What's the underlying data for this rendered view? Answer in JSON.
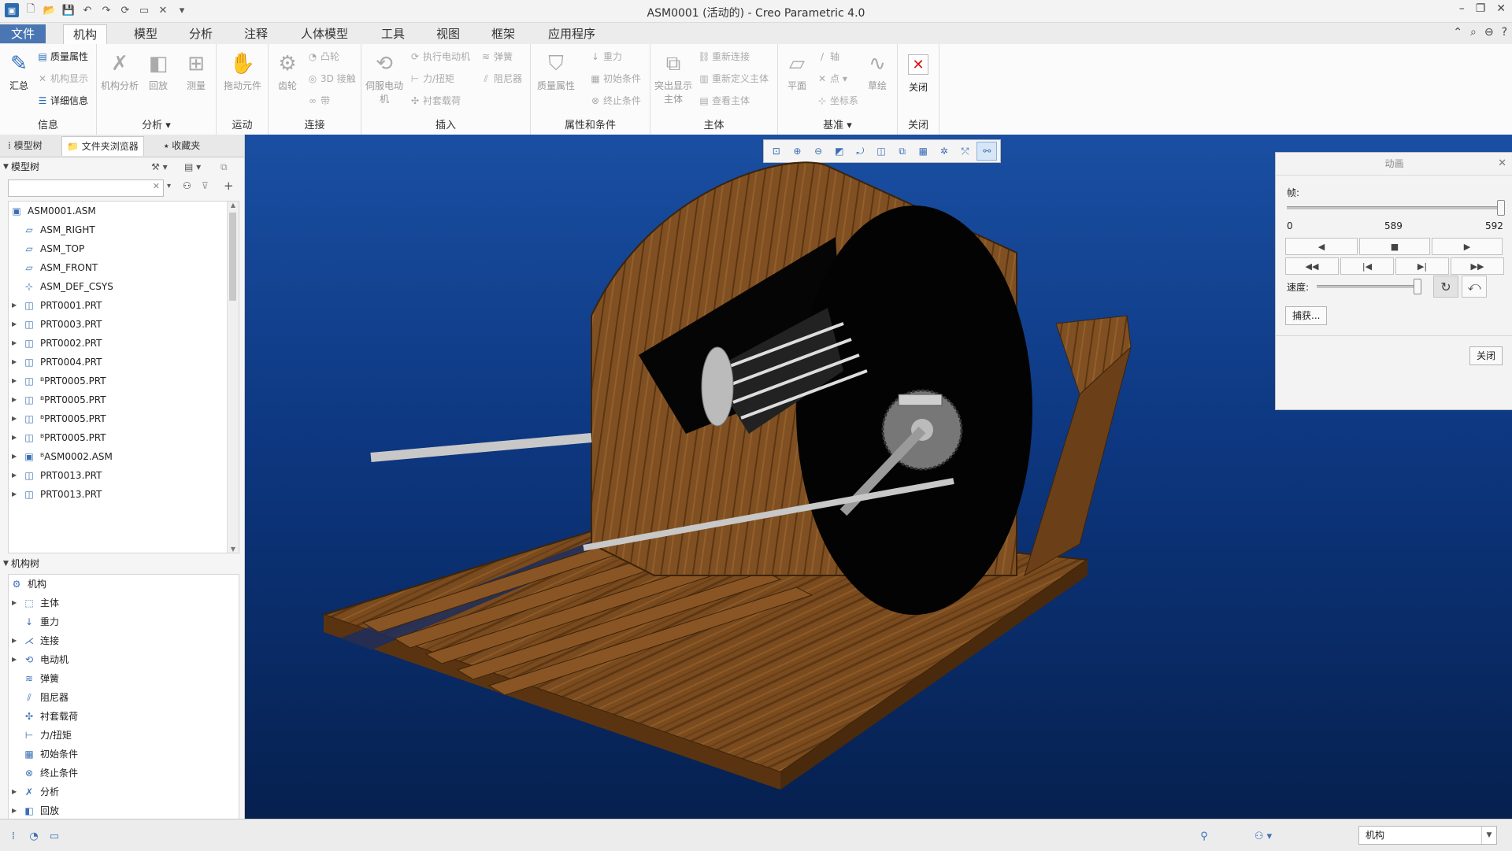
{
  "window": {
    "title": "ASM0001 (活动的) - Creo Parametric 4.0"
  },
  "tabs": [
    "文件",
    "机构",
    "模型",
    "分析",
    "注释",
    "人体模型",
    "工具",
    "视图",
    "框架",
    "应用程序"
  ],
  "ribbon": {
    "info": {
      "group": "信息",
      "summary": "汇总",
      "mass_props": "质量属性",
      "mech_display": "机构显示",
      "details": "详细信息"
    },
    "analysis": {
      "group": "分析",
      "mech_analysis": "机构分析",
      "playback": "回放",
      "measure": "测量"
    },
    "motion": {
      "group": "运动",
      "drag": "拖动元件"
    },
    "connect": {
      "group": "连接",
      "gear": "齿轮",
      "cam": "凸轮",
      "contact": "3D 接触",
      "belt": "带"
    },
    "insert": {
      "group": "插入",
      "servo": "伺服电动机",
      "exec_motor": "执行电动机",
      "force_torque": "力/扭矩",
      "bushing": "衬套载荷",
      "spring": "弹簧",
      "damper": "阻尼器"
    },
    "props": {
      "group": "属性和条件",
      "mass_props": "质量属性",
      "gravity": "重力",
      "init_cond": "初始条件",
      "term_cond": "终止条件"
    },
    "body": {
      "group": "主体",
      "highlight": "突出显示主体",
      "reconnect": "重新连接",
      "redefine": "重新定义主体",
      "view": "查看主体"
    },
    "datum": {
      "group": "基准",
      "plane": "平面",
      "axis": "轴",
      "point": "点",
      "csys": "坐标系",
      "sketch": "草绘"
    },
    "close": {
      "group": "关闭",
      "close": "关闭"
    }
  },
  "left_panel": {
    "tabs": [
      "模型树",
      "文件夹浏览器",
      "收藏夹"
    ],
    "model_tree": {
      "header": "模型树",
      "items": [
        {
          "label": "ASM0001.ASM",
          "icon": "assembly-icon",
          "expand": ""
        },
        {
          "label": "ASM_RIGHT",
          "icon": "datum-plane-icon",
          "expand": ""
        },
        {
          "label": "ASM_TOP",
          "icon": "datum-plane-icon",
          "expand": ""
        },
        {
          "label": "ASM_FRONT",
          "icon": "datum-plane-icon",
          "expand": ""
        },
        {
          "label": "ASM_DEF_CSYS",
          "icon": "csys-icon",
          "expand": ""
        },
        {
          "label": "PRT0001.PRT",
          "icon": "part-icon",
          "expand": "▶"
        },
        {
          "label": "PRT0003.PRT",
          "icon": "part-icon",
          "expand": "▶"
        },
        {
          "label": "PRT0002.PRT",
          "icon": "part-icon",
          "expand": "▶"
        },
        {
          "label": "PRT0004.PRT",
          "icon": "part-icon",
          "expand": "▶"
        },
        {
          "label": "ᴮPRT0005.PRT",
          "icon": "part-icon",
          "expand": "▶"
        },
        {
          "label": "ᴮPRT0005.PRT",
          "icon": "part-icon",
          "expand": "▶"
        },
        {
          "label": "ᴮPRT0005.PRT",
          "icon": "part-icon",
          "expand": "▶"
        },
        {
          "label": "ᴮPRT0005.PRT",
          "icon": "part-icon",
          "expand": "▶"
        },
        {
          "label": "ᴮASM0002.ASM",
          "icon": "assembly-icon",
          "expand": "▶"
        },
        {
          "label": "PRT0013.PRT",
          "icon": "part-icon",
          "expand": "▶"
        },
        {
          "label": "PRT0013.PRT",
          "icon": "part-icon",
          "expand": "▶"
        }
      ]
    },
    "mech_tree": {
      "header": "机构树",
      "items": [
        {
          "label": "机构",
          "icon": "mechanism-icon",
          "expand": ""
        },
        {
          "label": "主体",
          "icon": "body-icon",
          "expand": "▶"
        },
        {
          "label": "重力",
          "icon": "gravity-icon",
          "expand": ""
        },
        {
          "label": "连接",
          "icon": "connection-icon",
          "expand": "▶"
        },
        {
          "label": "电动机",
          "icon": "motor-icon",
          "expand": "▶"
        },
        {
          "label": "弹簧",
          "icon": "spring-icon",
          "expand": ""
        },
        {
          "label": "阻尼器",
          "icon": "damper-icon",
          "expand": ""
        },
        {
          "label": "衬套载荷",
          "icon": "bushing-icon",
          "expand": ""
        },
        {
          "label": "力/扭矩",
          "icon": "force-icon",
          "expand": ""
        },
        {
          "label": "初始条件",
          "icon": "initial-condition-icon",
          "expand": ""
        },
        {
          "label": "终止条件",
          "icon": "termination-icon",
          "expand": ""
        },
        {
          "label": "分析",
          "icon": "analysis-icon",
          "expand": "▶"
        },
        {
          "label": "回放",
          "icon": "playback-icon",
          "expand": "▶"
        }
      ]
    }
  },
  "animation_dialog": {
    "title": "动画",
    "frame_label": "帧:",
    "frame_min": "0",
    "frame_current": "589",
    "frame_max": "592",
    "frame_fraction": 0.995,
    "speed_label": "速度:",
    "speed_fraction": 0.98,
    "capture": "捕获...",
    "close": "关闭"
  },
  "status_bar": {
    "filter_value": "机构"
  },
  "colors": {
    "file_tab": "#4a77b3",
    "accent": "#2a6bb5",
    "viewport_top": "#1a4fa3",
    "viewport_bottom": "#06204f",
    "wood": "#7a4b1e"
  }
}
